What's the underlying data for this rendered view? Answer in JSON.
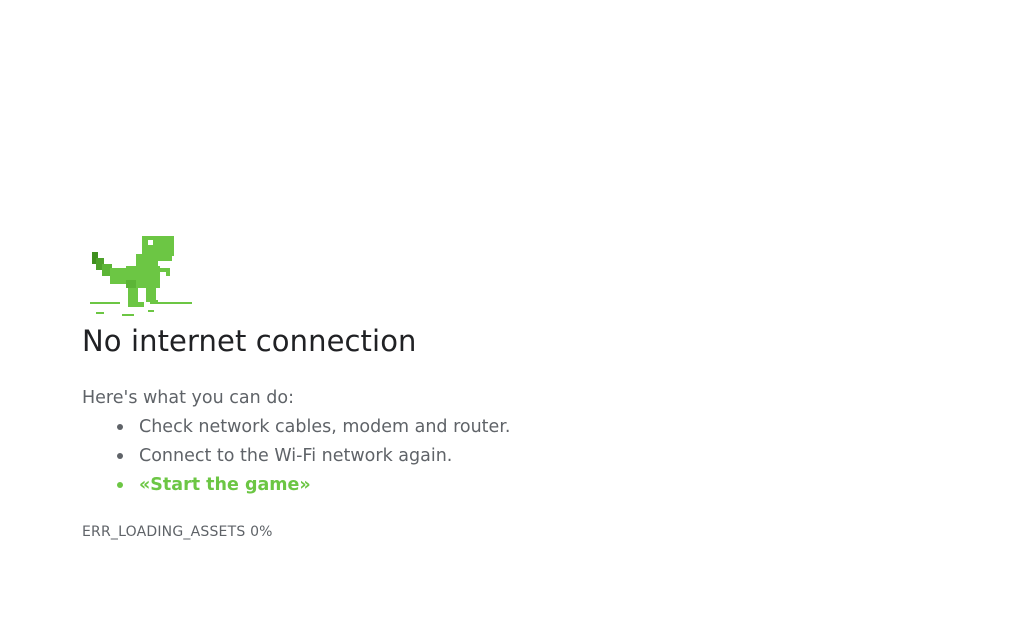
{
  "error_page": {
    "icon": "dino-icon",
    "title": "No internet connection",
    "intro": "Here's what you can do:",
    "suggestions": [
      "Check network cables, modem and router.",
      "Connect to the Wi-Fi network again."
    ],
    "game_link": "«Start the game»",
    "error_code": "ERR_LOADING_ASSETS 0%"
  },
  "colors": {
    "accent_green": "#6cc644",
    "dino_dark": "#3f8f1f",
    "text_primary": "#202124",
    "text_secondary": "#5f6368",
    "background": "#ffffff"
  }
}
